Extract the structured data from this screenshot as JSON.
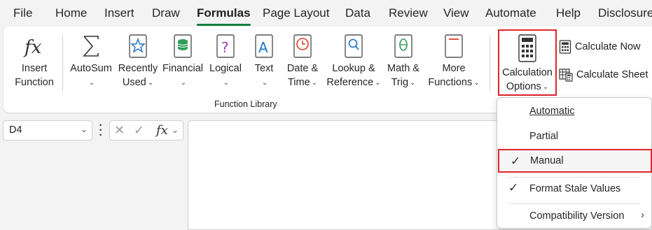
{
  "menu": {
    "tabs": [
      "File",
      "Home",
      "Insert",
      "Draw",
      "Formulas",
      "Page Layout",
      "Data",
      "Review",
      "View",
      "Automate",
      "Help",
      "Disclosure"
    ],
    "active": "Formulas"
  },
  "ribbon": {
    "insert_function": [
      "Insert",
      "Function"
    ],
    "autosum": "AutoSum",
    "recently_used": [
      "Recently",
      "Used"
    ],
    "financial": "Financial",
    "logical": "Logical",
    "text": "Text",
    "date_time": [
      "Date &",
      "Time"
    ],
    "lookup_reference": [
      "Lookup &",
      "Reference"
    ],
    "math_trig": [
      "Math &",
      "Trig"
    ],
    "more_functions": [
      "More",
      "Functions"
    ],
    "group_label": "Function Library",
    "calculation_options": [
      "Calculation",
      "Options"
    ],
    "calculate_now": "Calculate Now",
    "calculate_sheet": "Calculate Sheet"
  },
  "formula_bar": {
    "name_box": "D4",
    "fx": "fx"
  },
  "calc_menu": {
    "items": [
      {
        "label": "Automatic",
        "checked": false
      },
      {
        "label": "Partial",
        "checked": false
      },
      {
        "label": "Manual",
        "checked": true
      },
      {
        "label": "Format Stale Values",
        "checked": true
      },
      {
        "label": "Compatibility Version",
        "submenu": true
      }
    ]
  },
  "colors": {
    "accent_green": "#117e3c",
    "highlight_red": "#e0242c"
  }
}
